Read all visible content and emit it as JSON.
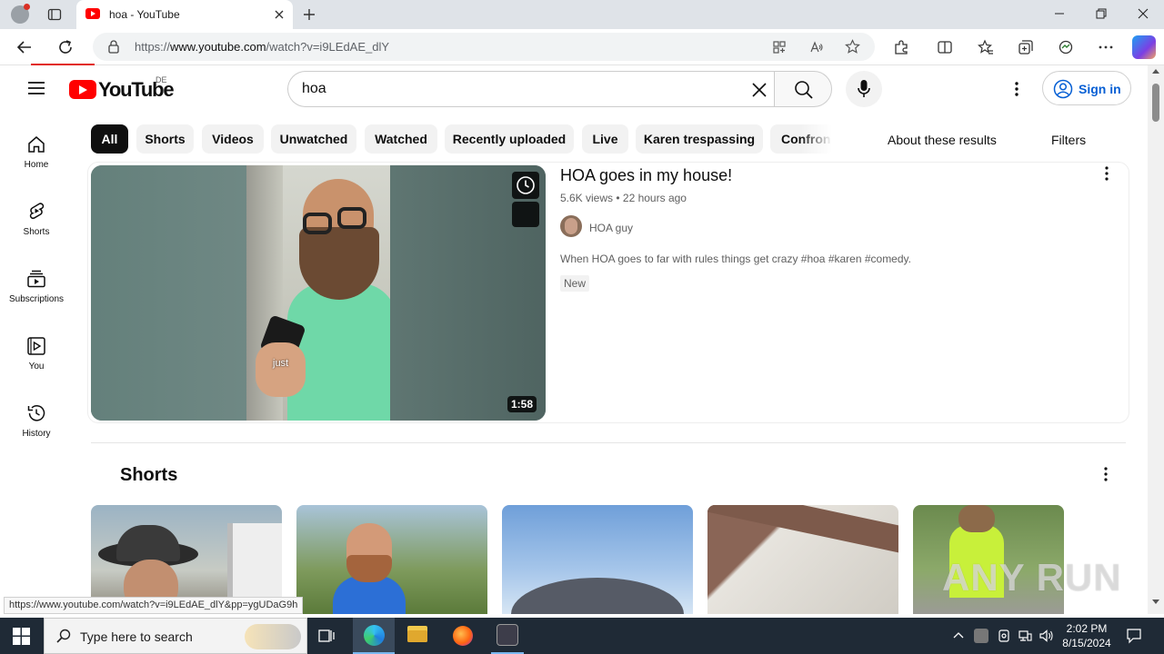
{
  "browser": {
    "tab_title": "hoa - YouTube",
    "url_prefix": "https://",
    "url_host": "www.youtube.com",
    "url_path": "/watch?v=i9LEdAE_dlY",
    "status_url": "https://www.youtube.com/watch?v=i9LEdAE_dlY&pp=ygUDaG9h"
  },
  "youtube": {
    "logo_text": "YouTube",
    "country_code": "DE",
    "search_value": "hoa",
    "sign_in_label": "Sign in",
    "chips": [
      "All",
      "Shorts",
      "Videos",
      "Unwatched",
      "Watched",
      "Recently uploaded",
      "Live",
      "Karen trespassing",
      "Confron"
    ],
    "about_results": "About these results",
    "filters_label": "Filters",
    "sidebar": [
      {
        "label": "Home",
        "icon": "home-icon"
      },
      {
        "label": "Shorts",
        "icon": "shorts-icon"
      },
      {
        "label": "Subscriptions",
        "icon": "subscriptions-icon"
      },
      {
        "label": "You",
        "icon": "you-icon"
      },
      {
        "label": "History",
        "icon": "history-icon"
      }
    ],
    "video": {
      "title": "HOA goes in my house!",
      "views": "5.6K views",
      "age": "22 hours ago",
      "channel": "HOA guy",
      "description": "When HOA goes to far with rules things get crazy #hoa #karen #comedy.",
      "badge": "New",
      "duration": "1:58",
      "caption": "just"
    },
    "shorts_heading": "Shorts"
  },
  "taskbar": {
    "search_placeholder": "Type here to search",
    "time": "2:02 PM",
    "date": "8/15/2024"
  },
  "watermark": "ANY RUN",
  "colors": {
    "youtube_red": "#ff0000",
    "link_blue": "#065fd4",
    "taskbar": "#1f2a36"
  }
}
